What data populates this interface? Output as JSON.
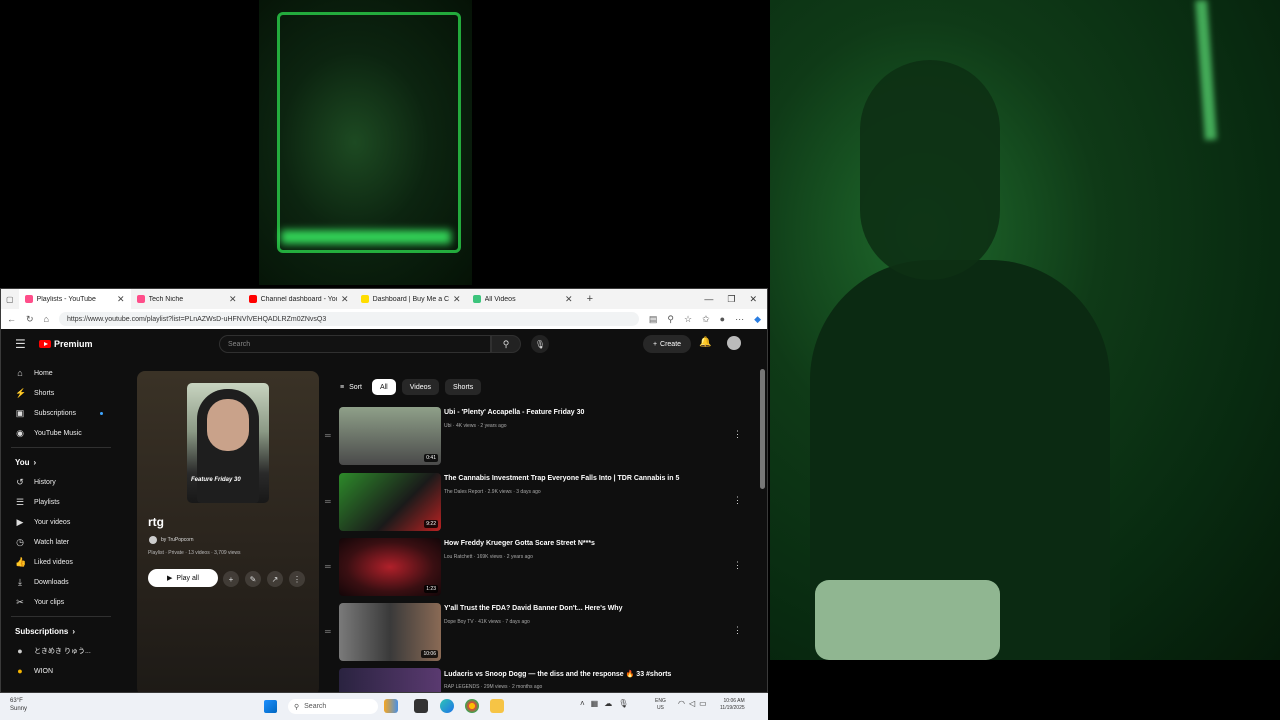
{
  "browser": {
    "tabs": [
      {
        "label": "Playlists - YouTube",
        "color": "#ff4e8a"
      },
      {
        "label": "Tech Niche",
        "color": "#ff4e8a"
      },
      {
        "label": "Channel dashboard - YouTub",
        "color": "#ff0000"
      },
      {
        "label": "Dashboard | Buy Me a Coffee",
        "color": "#ffdd00"
      },
      {
        "label": "All Videos",
        "color": "#3cc47c"
      }
    ],
    "url": "https://www.youtube.com/playlist?list=PLnAZWsD-uHFNVlVEHQADLRZm0ZNvsQ3"
  },
  "yt": {
    "brand": "Premium",
    "search_placeholder": "Search",
    "create_label": "Create",
    "sidebar": [
      {
        "label": "Home",
        "icon": "home-icon",
        "glyph": "⌂"
      },
      {
        "label": "Shorts",
        "icon": "shorts-icon",
        "glyph": "⚡"
      },
      {
        "label": "Subscriptions",
        "icon": "subscriptions-icon",
        "glyph": "▣"
      },
      {
        "label": "YouTube Music",
        "icon": "music-icon",
        "glyph": "◉"
      }
    ],
    "you_label": "You",
    "you_items": [
      {
        "label": "History",
        "glyph": "↺"
      },
      {
        "label": "Playlists",
        "glyph": "☰"
      },
      {
        "label": "Your videos",
        "glyph": "▶"
      },
      {
        "label": "Watch later",
        "glyph": "◷"
      },
      {
        "label": "Liked videos",
        "glyph": "👍"
      },
      {
        "label": "Downloads",
        "glyph": "⤓"
      },
      {
        "label": "Your clips",
        "glyph": "✂"
      }
    ],
    "subs_label": "Subscriptions",
    "subs": [
      {
        "label": "ときめき りゅう...",
        "glyph": "●"
      },
      {
        "label": "WION",
        "glyph": "●"
      }
    ],
    "playlist": {
      "title": "rtg",
      "owner": "by TruPopcorn",
      "meta": "Playlist · Private · 13 videos · 3,709 views",
      "play_all": "Play all",
      "thumb_caption": "Feature Friday 30"
    },
    "filters": {
      "sort": "Sort",
      "chips": [
        "All",
        "Videos",
        "Shorts"
      ]
    },
    "videos": [
      {
        "title": "Ubi - 'Plenty' Accapella - Feature Friday 30",
        "meta": "Ubi · 4K views · 2 years ago",
        "duration": "0:41",
        "thumb": "#6b7a66"
      },
      {
        "title": "The Cannabis Investment Trap Everyone Falls Into | TDR Cannabis in 5",
        "meta": "The Dales Report · 2.9K views · 3 days ago",
        "duration": "9:22",
        "thumb": "#2d8a2a"
      },
      {
        "title": "How Freddy Krueger Gotta Scare Street N***s",
        "meta": "Lou Ratchett · 169K views · 2 years ago",
        "duration": "1:23",
        "thumb": "#3a0f12"
      },
      {
        "title": "Y'all Trust the FDA? David Banner Don't... Here's Why",
        "meta": "Dope Boy TV · 41K views · 7 days ago",
        "duration": "10:06",
        "thumb": "#565656"
      },
      {
        "title": "Ludacris vs Snoop Dogg — the diss and the response 🔥 33 #shorts",
        "meta": "RAP LEGENDS · 29M views · 2 months ago",
        "duration": "",
        "thumb": "#2a2340"
      }
    ]
  },
  "taskbar": {
    "weather_temp": "63°F",
    "weather_desc": "Sunny",
    "search": "Search",
    "lang1": "ENG",
    "lang2": "US",
    "time": "10:06 AM",
    "date": "11/19/2025"
  }
}
